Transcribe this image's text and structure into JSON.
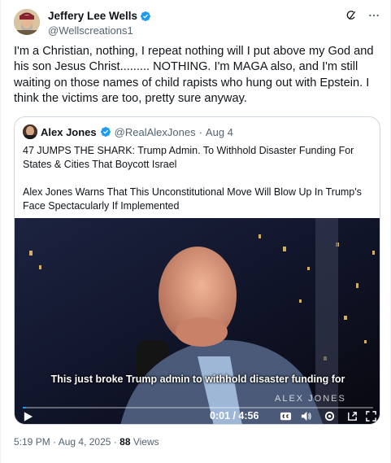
{
  "author": {
    "display_name": "Jeffery Lee Wells",
    "handle": "@Wellscreations1"
  },
  "tweet_text": "I'm a Christian, nothing, I repeat nothing will I put above my God and his son Jesus Christ......... NOTHING.  I'm MAGA also, and I'm still waiting on those names of child rapists who hung out with Epstein.  I think the victims are too, pretty sure anyway.",
  "quote": {
    "display_name": "Alex Jones",
    "handle": "@RealAlexJones",
    "separator": "·",
    "date": "Aug 4",
    "paragraph1": "47 JUMPS THE SHARK: Trump Admin. To Withhold Disaster Funding For States & Cities That Boycott Israel",
    "paragraph2": "Alex Jones Warns That This Unconstitutional Move Will Blow Up In Trump's Face Spectacularly If Implemented",
    "video": {
      "caption": "This just broke Trump admin to withhold disaster funding for",
      "watermark": "ALEX JONES",
      "time": "0:01 / 4:56",
      "progress": 0.01
    }
  },
  "meta": {
    "time": "5:19 PM",
    "separator1": "·",
    "date": "Aug 4, 2025",
    "separator2": "·",
    "views_count": "88",
    "views_label": "Views"
  },
  "colors": {
    "verified": "#1d9bf0",
    "secondary_text": "#536471",
    "border": "#cfd9de"
  },
  "icons": [
    "verified-badge-icon",
    "grok-icon",
    "more-icon",
    "play-icon",
    "captions-icon",
    "volume-icon",
    "settings-icon",
    "fullscreen-icon"
  ]
}
